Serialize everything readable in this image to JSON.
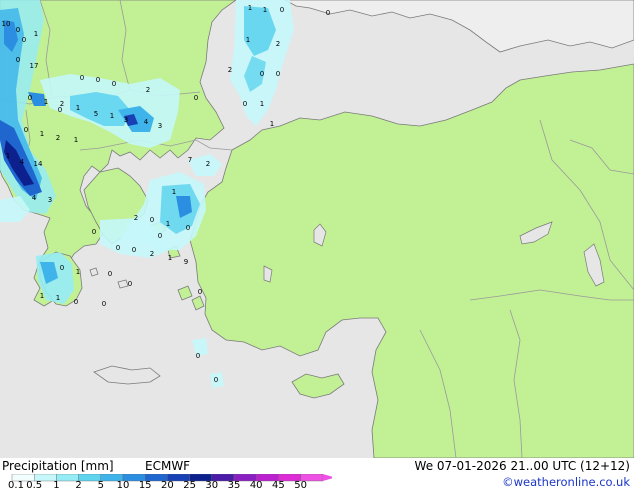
{
  "map": {
    "colors": {
      "sea": "#e6e6e6",
      "land_inside_model": "#c2f095",
      "land_outside": "#eeeeee",
      "border": "#9a9a9a",
      "coast": "#7a7a7a"
    },
    "point_values": [
      "1",
      "1",
      "0",
      "0",
      "10",
      "0",
      "1",
      "0",
      "17",
      "0",
      "1",
      "2",
      "0",
      "0",
      "0",
      "2",
      "0",
      "0",
      "2",
      "0",
      "0",
      "1",
      "2",
      "1",
      "0",
      "1",
      "5",
      "1",
      "3",
      "4",
      "3",
      "1",
      "0",
      "1",
      "2",
      "1",
      "7",
      "2",
      "1",
      "4",
      "14",
      "4",
      "3",
      "1",
      "2",
      "0",
      "1",
      "0",
      "0",
      "0",
      "2",
      "1",
      "9",
      "0",
      "1",
      "1",
      "1",
      "0",
      "0",
      "0",
      "0",
      "0",
      "0",
      "0",
      "0",
      "0",
      "0"
    ]
  },
  "footer": {
    "title": "Precipitation [mm]",
    "model": "ECMWF",
    "valid": "We 07-01-2026 21..00 UTC (12+12)",
    "credit": "©weatheronline.co.uk",
    "scale": {
      "ticks": [
        "0.1",
        "0.5",
        "1",
        "2",
        "5",
        "10",
        "15",
        "20",
        "25",
        "30",
        "35",
        "40",
        "45",
        "50"
      ],
      "colors": [
        "#f2fdfe",
        "#c5f7fb",
        "#96ecf5",
        "#5fd4ef",
        "#3fb4ea",
        "#2c8ee0",
        "#2066cf",
        "#1741b4",
        "#0c218e",
        "#4b1ca8",
        "#8b20c2",
        "#bc21cf",
        "#dd2bd6",
        "#ee52e4"
      ]
    }
  }
}
